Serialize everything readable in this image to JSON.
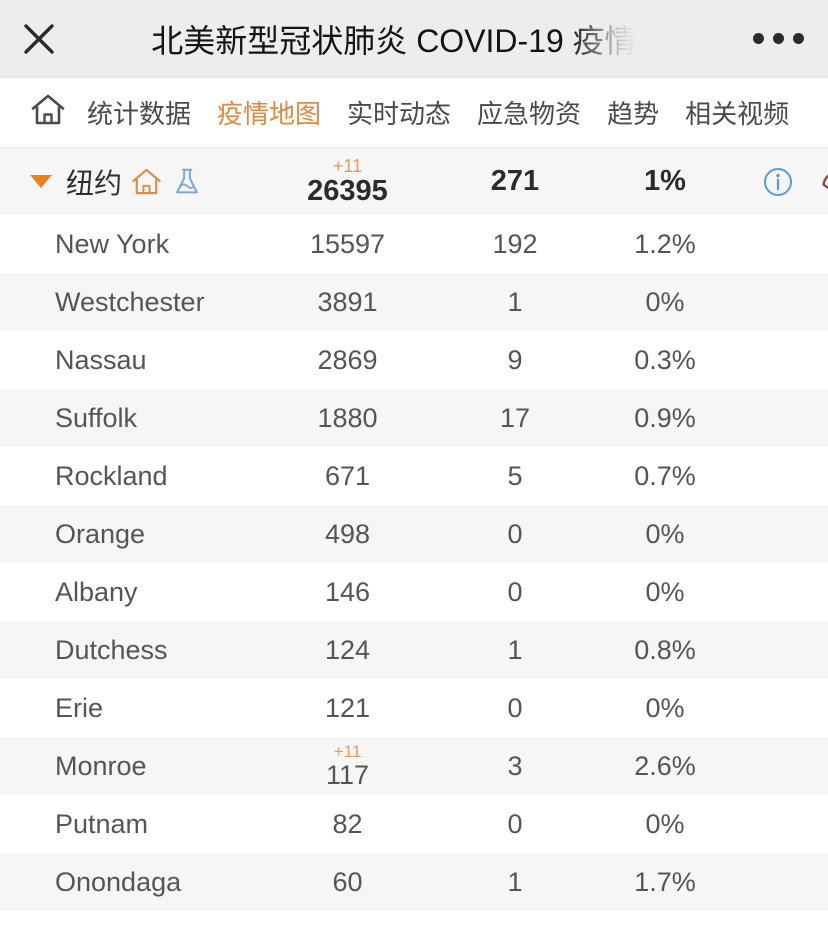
{
  "window": {
    "close_label": "×",
    "title": "北美新型冠状肺炎 COVID-19 疫情",
    "menu_label": "•••",
    "bar_bg": "#ededed"
  },
  "nav": {
    "home_icon": "home-icon",
    "active_color": "#e08840",
    "items": [
      {
        "label": "统计数据",
        "active": false
      },
      {
        "label": "疫情地图",
        "active": true
      },
      {
        "label": "实时动态",
        "active": false
      },
      {
        "label": "应急物资",
        "active": false
      },
      {
        "label": "趋势",
        "active": false
      },
      {
        "label": "相关视频",
        "active": false
      }
    ]
  },
  "region_header": {
    "expand_icon": "triangle-down-icon",
    "name": "纽约",
    "home_icon": "house-icon",
    "flask_icon": "flask-icon",
    "delta": "+11",
    "confirmed": "26395",
    "deaths": "271",
    "rate": "1%",
    "info_icon": "info-circle-icon",
    "phone_icon": "phone-icon",
    "delta_color": "#e49a5e",
    "info_color": "#5b9bd5",
    "phone_color": "#a8393c",
    "house_color": "#d7914f",
    "flask_color": "#7fa9d4"
  },
  "table": {
    "rows": [
      {
        "name": "New York",
        "delta": "",
        "confirmed": "15597",
        "deaths": "192",
        "rate": "1.2%"
      },
      {
        "name": "Westchester",
        "delta": "",
        "confirmed": "3891",
        "deaths": "1",
        "rate": "0%"
      },
      {
        "name": "Nassau",
        "delta": "",
        "confirmed": "2869",
        "deaths": "9",
        "rate": "0.3%"
      },
      {
        "name": "Suffolk",
        "delta": "",
        "confirmed": "1880",
        "deaths": "17",
        "rate": "0.9%"
      },
      {
        "name": "Rockland",
        "delta": "",
        "confirmed": "671",
        "deaths": "5",
        "rate": "0.7%"
      },
      {
        "name": "Orange",
        "delta": "",
        "confirmed": "498",
        "deaths": "0",
        "rate": "0%"
      },
      {
        "name": "Albany",
        "delta": "",
        "confirmed": "146",
        "deaths": "0",
        "rate": "0%"
      },
      {
        "name": "Dutchess",
        "delta": "",
        "confirmed": "124",
        "deaths": "1",
        "rate": "0.8%"
      },
      {
        "name": "Erie",
        "delta": "",
        "confirmed": "121",
        "deaths": "0",
        "rate": "0%"
      },
      {
        "name": "Monroe",
        "delta": "+11",
        "confirmed": "117",
        "deaths": "3",
        "rate": "2.6%"
      },
      {
        "name": "Putnam",
        "delta": "",
        "confirmed": "82",
        "deaths": "0",
        "rate": "0%"
      },
      {
        "name": "Onondaga",
        "delta": "",
        "confirmed": "60",
        "deaths": "1",
        "rate": "1.7%"
      }
    ]
  }
}
